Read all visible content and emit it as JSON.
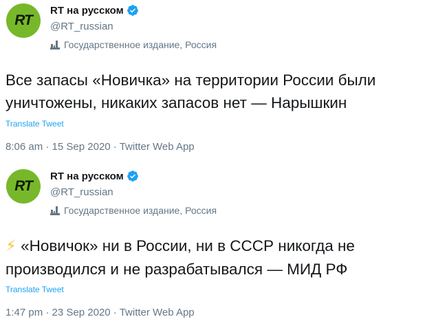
{
  "tweets": [
    {
      "avatar_text": "RT",
      "display_name": "RT на русском",
      "handle": "@RT_russian",
      "account_label": "Государственное издание, Россия",
      "text_line1": "Все запасы «Новичка» на территории России были",
      "text_line2": "уничтожены, никаких запасов нет — Нарышкин",
      "emoji": "",
      "translate_label": "Translate Tweet",
      "time": "8:06 am",
      "date": "15 Sep 2020",
      "source": "Twitter Web App"
    },
    {
      "avatar_text": "RT",
      "display_name": "RT на русском",
      "handle": "@RT_russian",
      "account_label": "Государственное издание, Россия",
      "emoji": "⚡",
      "text_line1": " «Новичок» ни в России, ни в СССР никогда не",
      "text_line2": "производился и не разрабатывался — МИД РФ",
      "translate_label": "Translate Tweet",
      "time": "1:47 pm",
      "date": "23 Sep 2020",
      "source": "Twitter Web App"
    }
  ],
  "separator": " · ",
  "icons": {
    "verified": "verified-badge-icon",
    "government": "state-media-icon",
    "bolt": "lightning-emoji"
  },
  "colors": {
    "avatar_bg": "#77b82a",
    "link": "#1da1f2",
    "secondary_text": "#657786",
    "verified": "#1da1f2"
  }
}
